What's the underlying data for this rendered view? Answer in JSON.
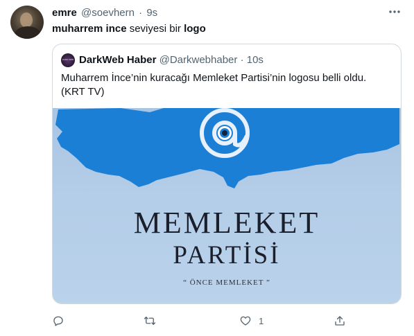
{
  "tweet": {
    "display_name": "emre",
    "handle": "@soevhern",
    "separator": "·",
    "time": "9s",
    "text_part1": "muharrem ince",
    "text_part2": " seviyesi bir ",
    "text_part3": "logo"
  },
  "quote": {
    "avatar_text": "DARK WEB",
    "display_name": "DarkWeb Haber",
    "handle": "@Darkwebhaber",
    "separator": "·",
    "time": "10s",
    "text": "Muharrem İnce’nin kuracağı Memleket Partisi’nin logosu belli oldu. (KRT TV)",
    "image": {
      "logo_line1": "MEMLEKET",
      "logo_line2": "PARTİSİ",
      "slogan": "“ ÖNCE MEMLEKET ”",
      "colors": {
        "background": "#b4cde8",
        "map": "#1c7fd6",
        "text": "#1a1f2b"
      }
    }
  },
  "actions": {
    "reply_icon": "reply-icon",
    "retweet_icon": "retweet-icon",
    "like_icon": "heart-icon",
    "like_count": "1",
    "share_icon": "share-icon"
  },
  "colors": {
    "secondary_text": "#536471",
    "border": "#cfd9de"
  }
}
